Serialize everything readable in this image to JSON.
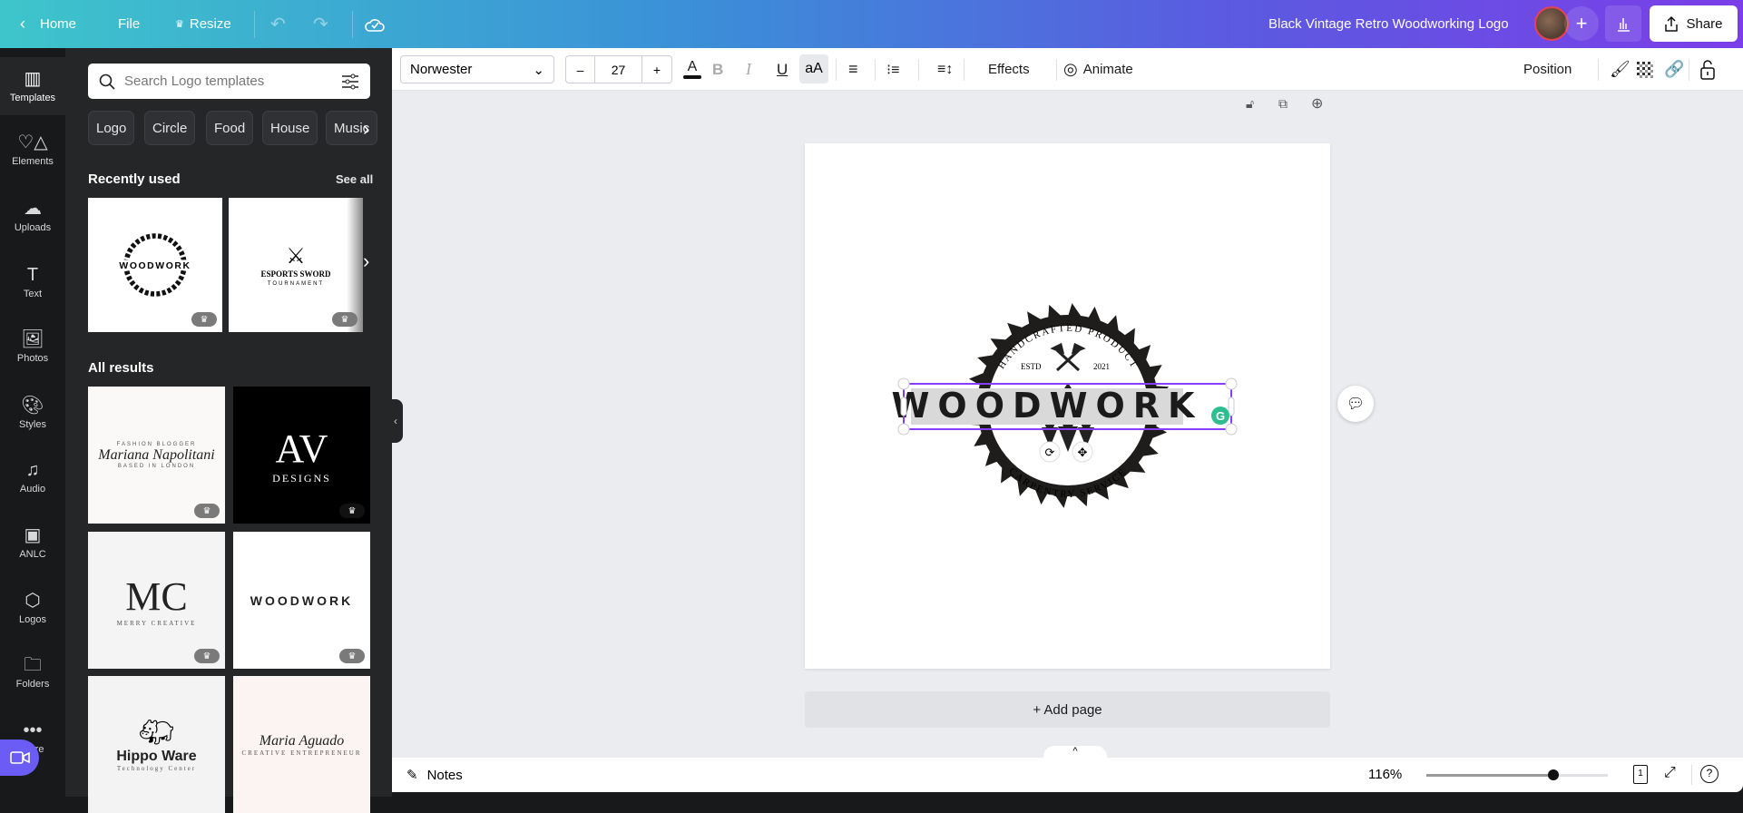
{
  "topbar": {
    "home": "Home",
    "file": "File",
    "resize": "Resize",
    "title": "Black Vintage Retro Woodworking Logo",
    "share": "Share",
    "icons": [
      "chevron-left-icon",
      "crown-icon",
      "undo-icon",
      "redo-icon",
      "cloud-saved-icon",
      "plus-icon",
      "analytics-icon",
      "share-upload-icon"
    ]
  },
  "rail": [
    {
      "label": "Templates",
      "icon": "templates-icon"
    },
    {
      "label": "Elements",
      "icon": "elements-icon"
    },
    {
      "label": "Uploads",
      "icon": "upload-cloud-icon"
    },
    {
      "label": "Text",
      "icon": "text-icon"
    },
    {
      "label": "Photos",
      "icon": "photo-icon"
    },
    {
      "label": "Styles",
      "icon": "palette-icon"
    },
    {
      "label": "Audio",
      "icon": "music-note-icon"
    },
    {
      "label": "ANLC",
      "icon": "anlc-thumbnail"
    },
    {
      "label": "Logos",
      "icon": "logos-icon"
    },
    {
      "label": "Folders",
      "icon": "folder-icon"
    },
    {
      "label": "More",
      "icon": "more-icon"
    }
  ],
  "panel": {
    "search_placeholder": "Search Logo templates",
    "chips": [
      "Logo",
      "Circle",
      "Food",
      "House",
      "Music"
    ],
    "recent_heading": "Recently used",
    "see_all": "See all",
    "recent": [
      {
        "title": "WOODWORK"
      },
      {
        "title": "ESPORTS SWORD",
        "subtitle": "TOURNAMENT"
      }
    ],
    "results_heading": "All results",
    "results": [
      {
        "title": "Mariana Napolitani",
        "top": "FASHION BLOGGER",
        "bottom": "BASED IN LONDON",
        "bg": "#faf9f7"
      },
      {
        "title": "AV",
        "subtitle": "DESIGNS",
        "bg": "#000000"
      },
      {
        "title": "MC",
        "subtitle": "MERRY CREATIVE",
        "bg": "#f4f4f4"
      },
      {
        "title": "WOODWORK",
        "bg": "#ffffff"
      },
      {
        "title": "Hippo Ware",
        "subtitle": "Technology Center",
        "bg": "#f3f3f3"
      },
      {
        "title": "Maria Aguado",
        "subtitle": "CREATIVE ENTREPRENEUR",
        "bg": "#fcf3f3"
      }
    ]
  },
  "toolbar": {
    "font": "Norwester",
    "font_size": "27",
    "minus": "–",
    "plus": "+",
    "bold": "B",
    "italic": "I",
    "underline": "U",
    "case": "aA",
    "effects": "Effects",
    "animate": "Animate",
    "position": "Position"
  },
  "canvas": {
    "logo": {
      "top_arc": "HANDCRAFTED PRODUCT",
      "estd": "ESTD",
      "year": "2021",
      "title": "WOODWORK",
      "bottom_arc": "CARPENTRY SERVICE"
    },
    "add_page": "+ Add page",
    "accent": "#8b3dff"
  },
  "bottombar": {
    "notes": "Notes",
    "zoom": "116%",
    "zoom_level": 0.7,
    "page_count": "1"
  }
}
